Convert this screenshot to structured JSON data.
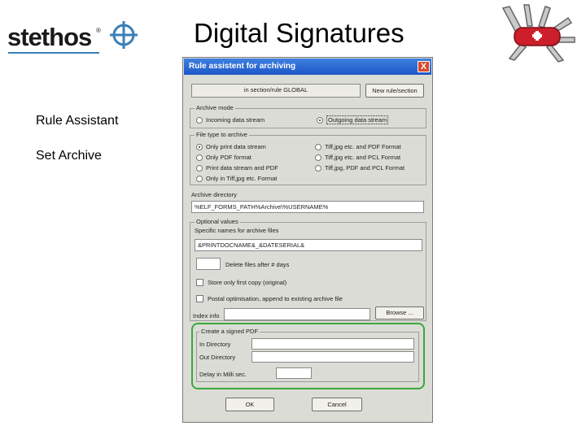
{
  "slide": {
    "logo_text": "stethos",
    "logo_reg": "®",
    "title": "Digital Signatures",
    "bullets": [
      "Rule Assistant",
      "Set Archive"
    ]
  },
  "colors": {
    "logo_accent": "#3a7fb8",
    "title_bar": "#1d56c8",
    "highlight": "#3aa83a",
    "knife": "#cc1f2b"
  },
  "icons": {
    "logo": "crosshair-logo-icon",
    "knife": "swiss-army-knife-icon",
    "close": "close-icon"
  },
  "dialog": {
    "title": "Rule assistent for archiving",
    "close": "X",
    "section_field": "in section/rule GLOBAL",
    "new_rule_button": "New rule/section",
    "archive_mode": {
      "label": "Archive mode",
      "options": [
        "Incoming data stream",
        "Outgoing data stream"
      ],
      "selected": "Outgoing data stream"
    },
    "file_type": {
      "label": "File type to archive",
      "left_options": [
        "Only print data stream",
        "Only PDF format",
        "Print data stream and PDF",
        "Only in Tiff,jpg etc. Format"
      ],
      "right_options": [
        "Tiff,jpg etc. and PDF Format",
        "Tiff,jpg etc. and PCL Format",
        "Tiff,jpg, PDF and PCL Format"
      ],
      "selected": "Only print data stream"
    },
    "archive_directory": {
      "label": "Archive directory",
      "value": "%ELF_FORMS_PATH%Archive\\%USERNAME%"
    },
    "optional": {
      "label": "Optional values",
      "spec_label": "Specific names for archive files",
      "spec_value": "&PRINTDOCNAME&_&DATESERIAL&",
      "delete_value": "",
      "delete_label": "Delete files after # days",
      "store_label": "Store only first copy (original)",
      "postal_label": "Postal optimisation, append to existing archive file",
      "index_label": "Index info",
      "index_value": "",
      "browse_button": "Browse ..."
    },
    "signed_pdf": {
      "label": "Create a signed PDF",
      "in_label": "In Directory",
      "in_value": "",
      "out_label": "Out Directory",
      "out_value": "",
      "delay_label": "Delay in Milli sec.",
      "delay_value": ""
    },
    "ok_button": "OK",
    "cancel_button": "Cancel"
  }
}
